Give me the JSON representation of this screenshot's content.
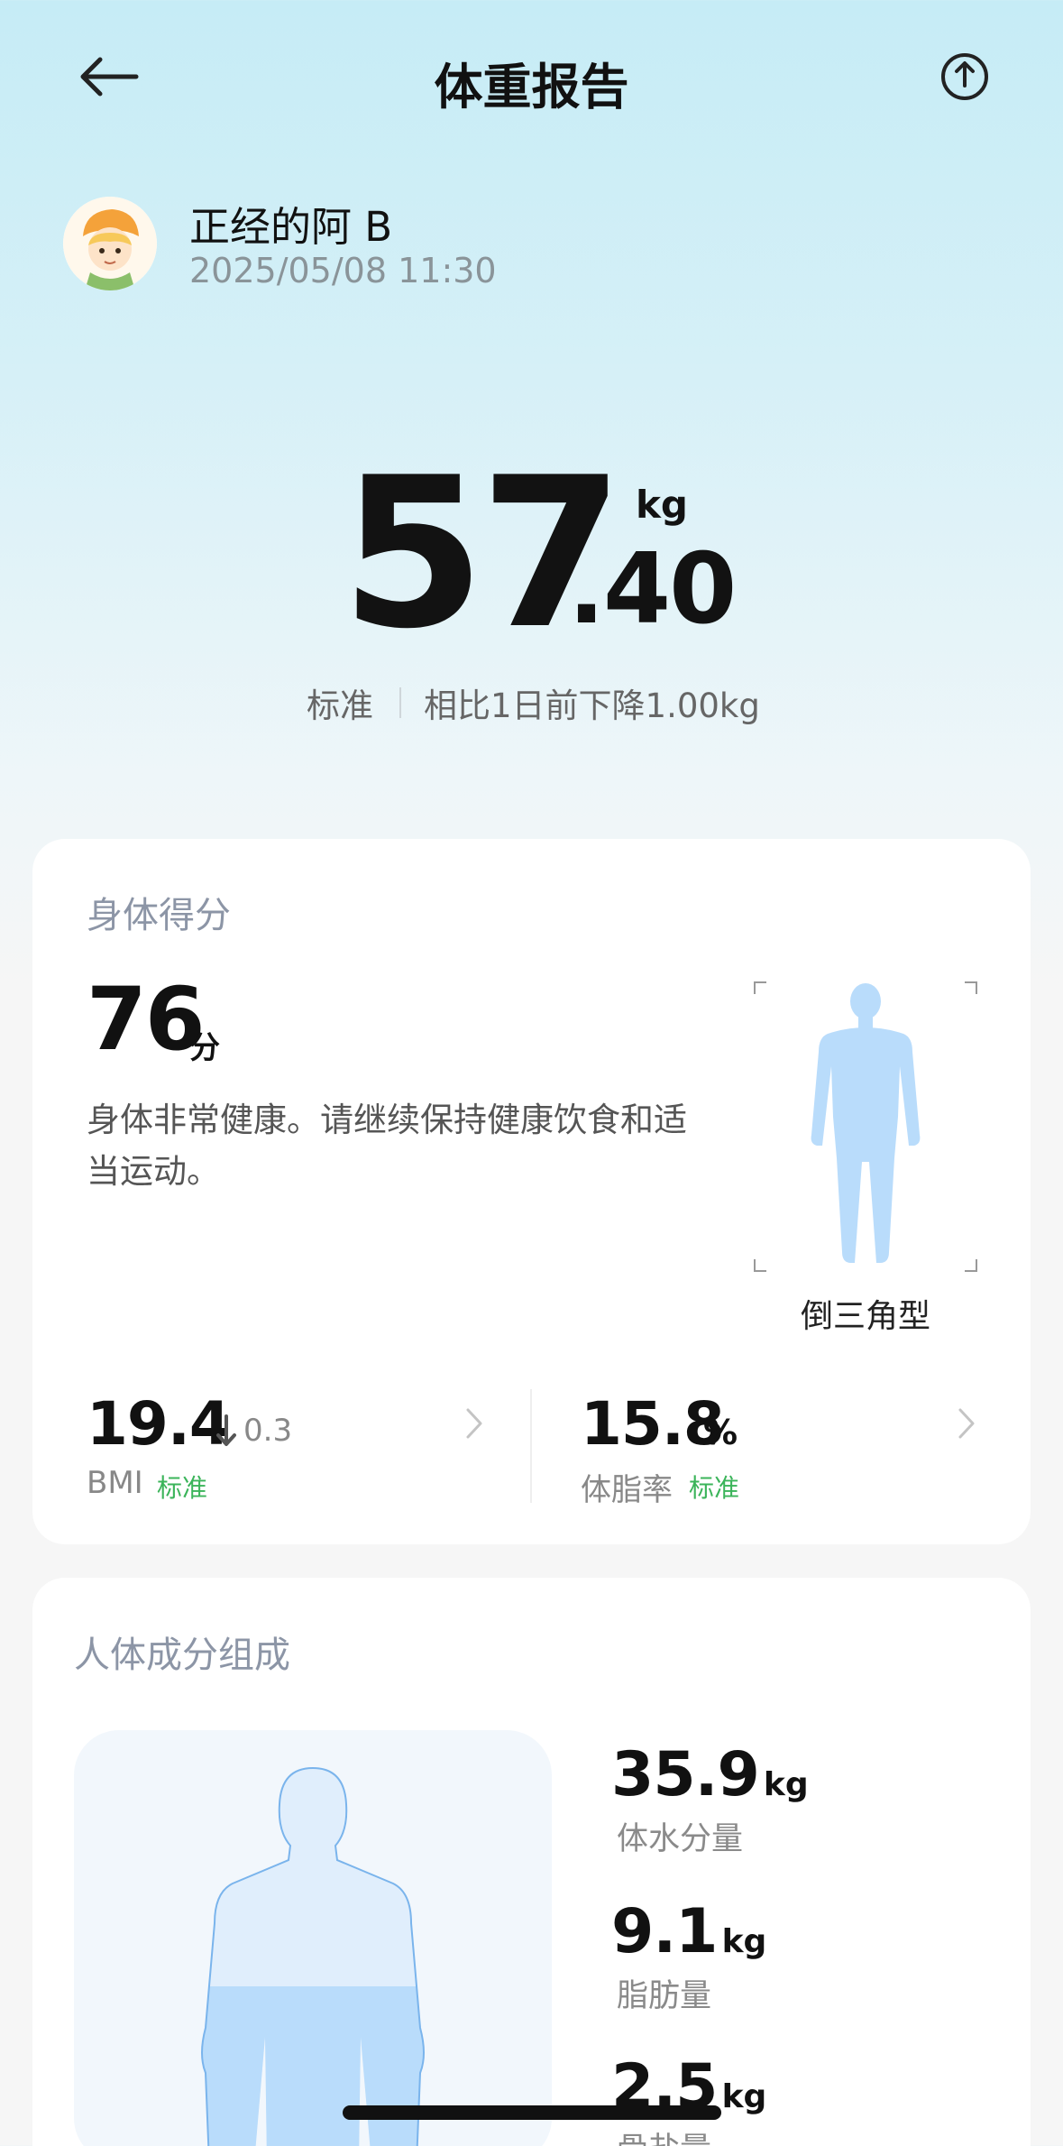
{
  "header": {
    "title": "体重报告",
    "back_icon": "back-arrow-icon",
    "share_icon": "share-icon"
  },
  "user": {
    "name": "正经的阿 B",
    "datetime": "2025/05/08 11:30"
  },
  "weight": {
    "integer": "57",
    "decimal": ".40",
    "unit": "kg",
    "status": "标准",
    "change": "相比1日前下降1.00kg"
  },
  "body_score": {
    "title": "身体得分",
    "score": "76",
    "unit": "分",
    "description": "身体非常健康。请继续保持健康饮食和适当运动。",
    "body_type": "倒三角型"
  },
  "metrics": [
    {
      "value": "19.4",
      "change": "0.3",
      "change_direction": "down",
      "label": "BMI",
      "status": "标准"
    },
    {
      "value": "15.8",
      "unit": "%",
      "label": "体脂率",
      "status": "标准"
    }
  ],
  "composition": {
    "title": "人体成分组成",
    "items": [
      {
        "value": "35.9",
        "unit": "kg",
        "label": "体水分量"
      },
      {
        "value": "9.1",
        "unit": "kg",
        "label": "脂肪量"
      },
      {
        "value": "2.5",
        "unit": "kg",
        "label": "骨盐量"
      }
    ]
  },
  "colors": {
    "accent_green": "#3bb45a",
    "figure_blue": "#b9dcfb",
    "title_gray": "#8c95a6"
  }
}
